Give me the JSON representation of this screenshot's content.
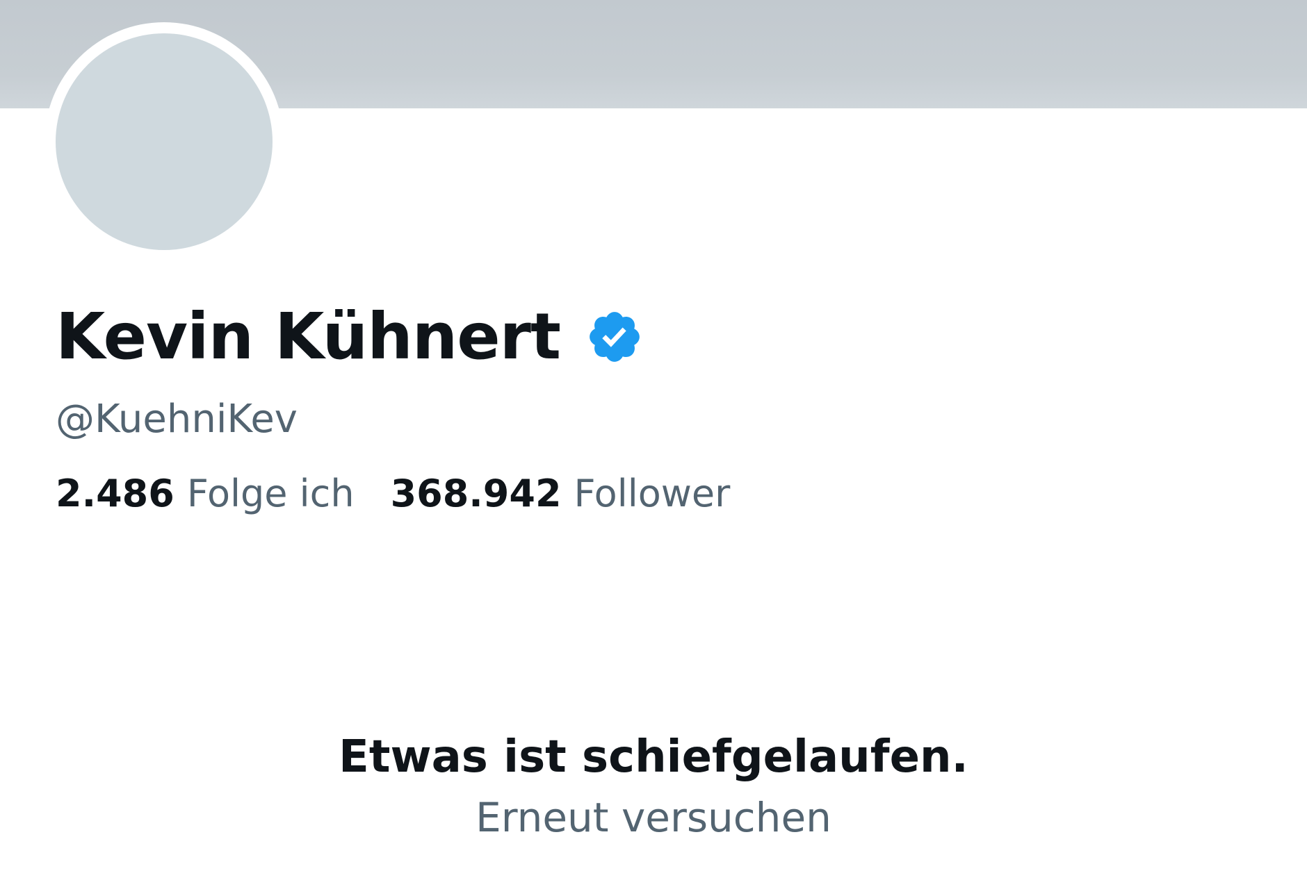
{
  "profile": {
    "display_name": "Kevin Kühnert",
    "handle": "@KuehniKev",
    "verified_icon": "verified-badge",
    "stats": {
      "following_count": "2.486",
      "following_label": "Folge ich",
      "followers_count": "368.942",
      "followers_label": "Follower"
    }
  },
  "error": {
    "title": "Etwas ist schiefgelaufen.",
    "retry_label": "Erneut versuchen"
  },
  "colors": {
    "banner": "#c7ced3",
    "avatar_placeholder": "#cfd9de",
    "verified_blue": "#1d9bf0",
    "text_primary": "#0f1419",
    "text_secondary": "#536471"
  }
}
